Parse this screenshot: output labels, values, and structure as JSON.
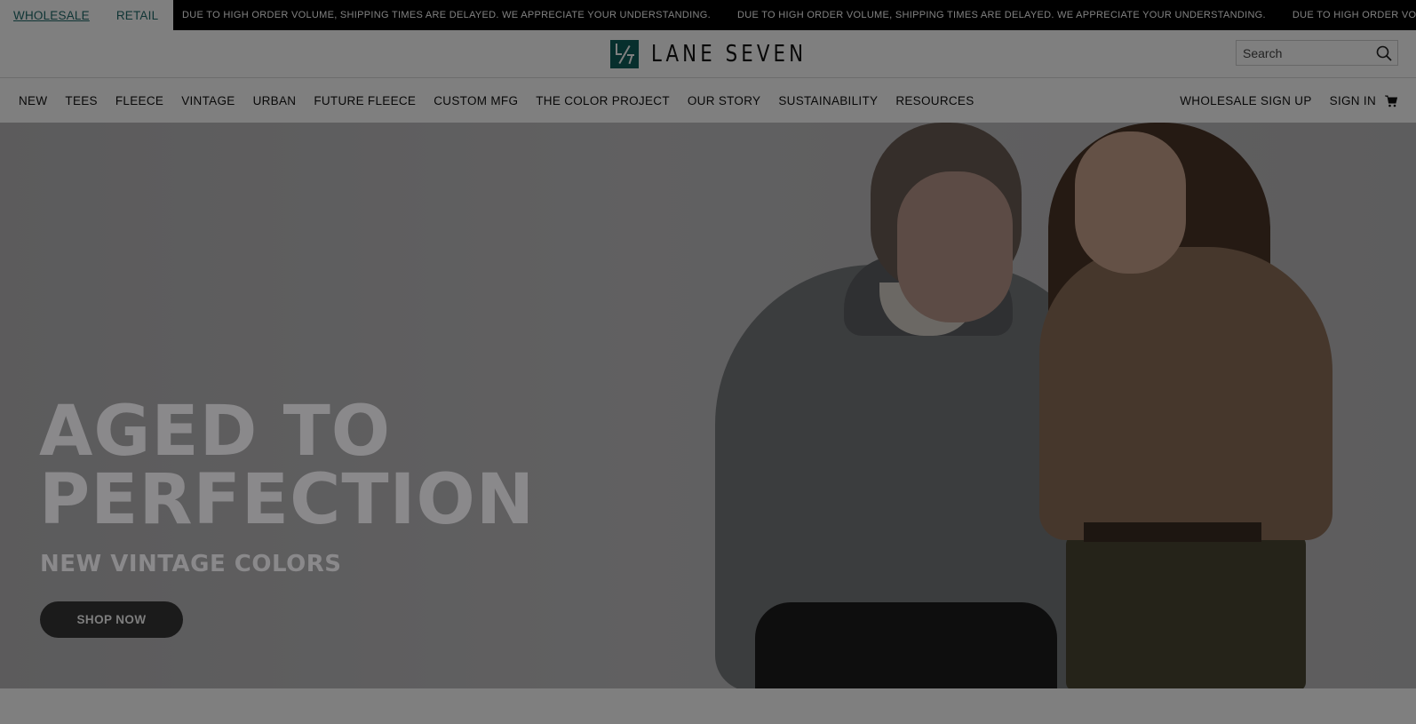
{
  "topbar": {
    "wholesale_label": "WHOLESALE",
    "retail_label": "RETAIL",
    "announcement": "DUE TO HIGH ORDER VOLUME, SHIPPING TIMES ARE DELAYED. WE APPRECIATE YOUR UNDERSTANDING.",
    "announcement_clipped": "DUE TO HIGH ORDER VOL"
  },
  "header": {
    "logo_text": "LANE SEVEN",
    "logo_color": "#0f5e5a",
    "search_placeholder": "Search"
  },
  "nav": {
    "left_items": [
      "NEW",
      "TEES",
      "FLEECE",
      "VINTAGE",
      "URBAN",
      "FUTURE FLEECE",
      "CUSTOM MFG",
      "THE COLOR PROJECT",
      "OUR STORY",
      "SUSTAINABILITY",
      "RESOURCES"
    ],
    "wholesale_signup": "WHOLESALE SIGN UP",
    "sign_in": "SIGN IN"
  },
  "hero": {
    "title_line1": "AGED TO",
    "title_line2": "PERFECTION",
    "subtitle": "NEW VINTAGE COLORS",
    "cta_label": "SHOP NOW"
  }
}
